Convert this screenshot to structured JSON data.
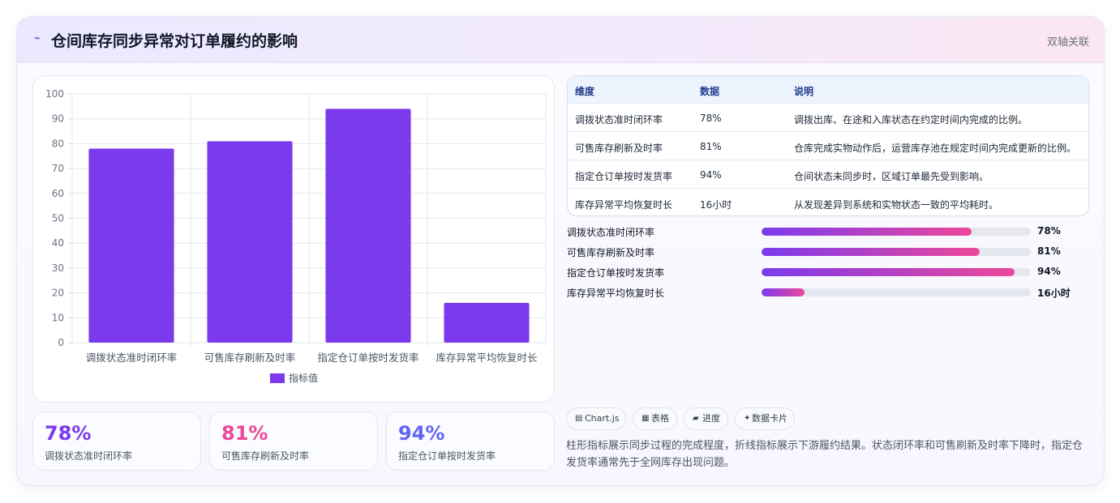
{
  "header": {
    "logo_icon": "trend-icon",
    "logo_glyph": "⌁",
    "title": "仓间库存同步异常对订单履约的影响",
    "tag": "双轴关联"
  },
  "chart_data": {
    "type": "bar",
    "categories": [
      "调拨状态准时闭环率",
      "可售库存刷新及时率",
      "指定仓订单按时发货率",
      "库存异常平均恢复时长"
    ],
    "series": [
      {
        "name": "指标值",
        "values": [
          78,
          81,
          94,
          16
        ],
        "color": "#7c3aed"
      }
    ],
    "ylim": [
      0,
      100
    ],
    "yticks": [
      0,
      10,
      20,
      30,
      40,
      50,
      60,
      70,
      80,
      90,
      100
    ],
    "grid": true,
    "legend": "bottom"
  },
  "stats": [
    {
      "value": "78%",
      "label": "调拨状态准时闭环率",
      "color": "#7c3aed"
    },
    {
      "value": "81%",
      "label": "可售库存刷新及时率",
      "color": "#ec4899"
    },
    {
      "value": "94%",
      "label": "指定仓订单按时发货率",
      "color": "#6366f1"
    }
  ],
  "table": {
    "headers": [
      "维度",
      "数据",
      "说明"
    ],
    "rows": [
      [
        "调拨状态准时闭环率",
        "78%",
        "调拨出库、在途和入库状态在约定时间内完成的比例。"
      ],
      [
        "可售库存刷新及时率",
        "81%",
        "仓库完成实物动作后，运营库存池在规定时间内完成更新的比例。"
      ],
      [
        "指定仓订单按时发货率",
        "94%",
        "仓间状态未同步时，区域订单最先受到影响。"
      ],
      [
        "库存异常平均恢复时长",
        "16小时",
        "从发现差异到系统和实物状态一致的平均耗时。"
      ]
    ]
  },
  "progress": [
    {
      "label": "调拨状态准时闭环率",
      "value": "78%",
      "fraction": 0.78
    },
    {
      "label": "可售库存刷新及时率",
      "value": "81%",
      "fraction": 0.81
    },
    {
      "label": "指定仓订单按时发货率",
      "value": "94%",
      "fraction": 0.94
    },
    {
      "label": "库存异常平均恢复时长",
      "value": "16小时",
      "fraction": 0.16
    }
  ],
  "chips": [
    {
      "icon": "chart-icon",
      "glyph": "▤",
      "label": "Chart.js"
    },
    {
      "icon": "table-icon",
      "glyph": "▦",
      "label": "表格"
    },
    {
      "icon": "progress-icon",
      "glyph": "▰",
      "label": "进度"
    },
    {
      "icon": "sparkle-icon",
      "glyph": "✦",
      "label": "数据卡片"
    }
  ],
  "note": "柱形指标展示同步过程的完成程度，折线指标展示下游履约结果。状态闭环率和可售刷新及时率下降时，指定仓发货率通常先于全网库存出现问题。"
}
